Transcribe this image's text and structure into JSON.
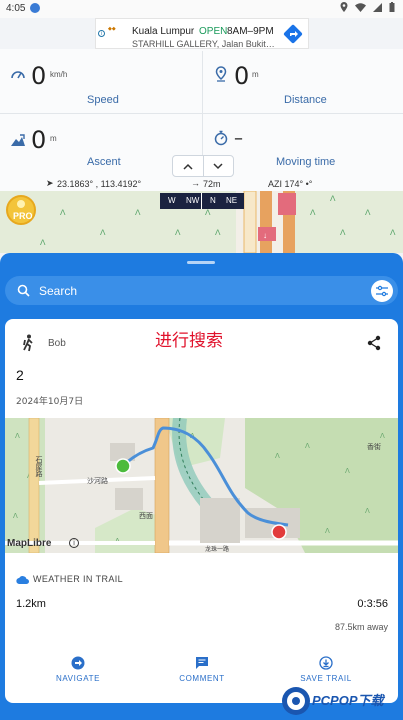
{
  "status_bar": {
    "time": "4:05"
  },
  "ad": {
    "line1": "Kuala Lumpur",
    "status": "OPEN",
    "hours": "8AM–9PM",
    "line2": "STARHILL GALLERY, Jalan Bukit…"
  },
  "stats": {
    "speed": {
      "value": "0",
      "unit": "km/h",
      "label": "Speed"
    },
    "distance": {
      "value": "0",
      "unit": "m",
      "label": "Distance"
    },
    "ascent": {
      "value": "0",
      "unit": "m",
      "label": "Ascent"
    },
    "moving_time": {
      "value": "–",
      "label": "Moving time"
    }
  },
  "coords": {
    "position": "23.1863° , 113.4192°",
    "distance": "72m",
    "azimuth": "AZI 174° •°"
  },
  "compass": {
    "headings": [
      "W",
      "NW",
      "N",
      "NE"
    ]
  },
  "pro_badge": "PRO",
  "search": {
    "placeholder": "Search"
  },
  "card": {
    "user": "Bob",
    "annotation": "进行搜索",
    "trail_name": "2",
    "date": "2024年10月7日",
    "map_attribution": "MapLibre",
    "map_labels": [
      "石屋路",
      "沙河路",
      "龙珠一路",
      "香街",
      "西面"
    ],
    "weather_label": "WEATHER IN TRAIL",
    "distance": "1.2km",
    "duration": "0:3:56",
    "away": "87.5km away",
    "actions": {
      "navigate": "NAVIGATE",
      "comment": "COMMENT",
      "save": "SAVE TRAIL"
    }
  },
  "watermark": "PCPOP下载",
  "colors": {
    "accent_blue": "#1e7be0",
    "label_blue": "#3a6ba8",
    "annotation_red": "#e0112b",
    "route_blue": "#4a8fd8"
  }
}
